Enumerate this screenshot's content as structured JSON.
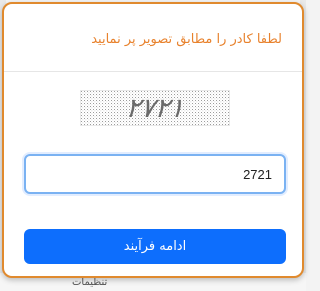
{
  "modal": {
    "title": "لطفا کادر را مطابق تصویر پر نمایید",
    "captcha_text": "۲۷۲۱",
    "input_value": "2721",
    "continue_label": "ادامه فرآیند"
  },
  "background": {
    "partial_text": "تنظیمات"
  },
  "colors": {
    "title": "#e8822d",
    "modal_border": "#e08a2e",
    "button": "#0d6efd",
    "input_focus_border": "#7ab2f2"
  }
}
